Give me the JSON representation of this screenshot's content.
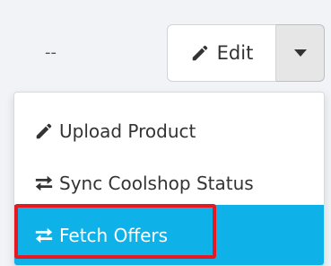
{
  "row": {
    "value": "--"
  },
  "toolbar": {
    "edit_label": "Edit",
    "edit_icon": "pencil-icon",
    "dropdown_icon": "caret-down-icon"
  },
  "menu": {
    "items": [
      {
        "label": "Upload Product",
        "icon": "pencil-icon"
      },
      {
        "label": "Sync Coolshop Status",
        "icon": "exchange-arrows-icon"
      },
      {
        "label": "Fetch Offers",
        "icon": "exchange-arrows-icon",
        "active": true
      }
    ]
  },
  "colors": {
    "active_background": "#0fb2e8",
    "active_text": "#ffffff",
    "highlight_border": "#e61923",
    "page_background": "#f1f3f7"
  }
}
